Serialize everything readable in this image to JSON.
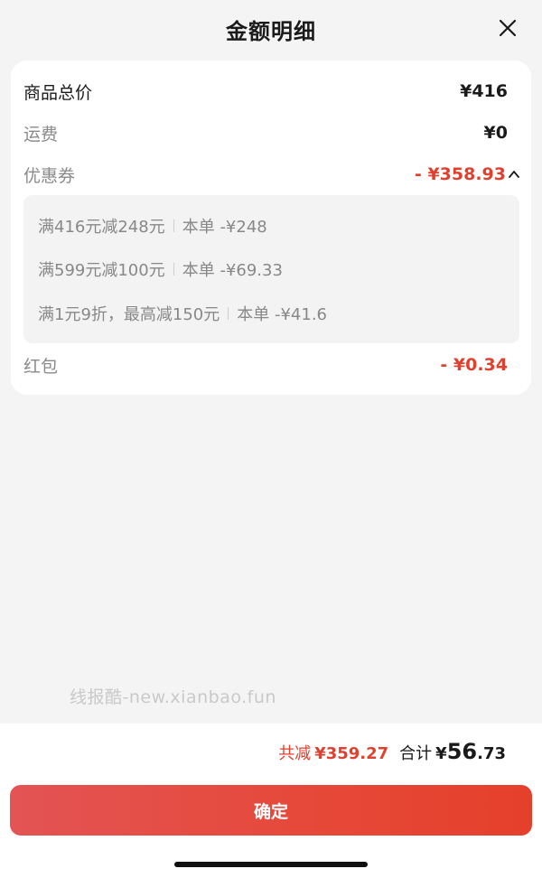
{
  "header": {
    "title": "金额明细",
    "close_icon": "close-icon"
  },
  "details": {
    "goods_total_label": "商品总价",
    "goods_total_value": "¥416",
    "shipping_label": "运费",
    "shipping_value": "¥0",
    "coupon_label": "优惠券",
    "coupon_value": "- ¥358.93",
    "coupon_toggle_icon": "chevron-up-icon",
    "coupons": [
      {
        "rule": "满416元减248元",
        "deduction": "本单 -¥248"
      },
      {
        "rule": "满599元减100元",
        "deduction": "本单 -¥69.33"
      },
      {
        "rule": "满1元9折，最高减150元",
        "deduction": "本单 -¥41.6"
      }
    ],
    "redpacket_label": "红包",
    "redpacket_value": "- ¥0.34"
  },
  "watermark": "线报酷-new.xianbao.fun",
  "footer": {
    "saved_label": "共减",
    "saved_amount": "¥359.27",
    "total_label": "合计",
    "total_currency": "¥",
    "total_integer": "56",
    "total_decimal": ".73",
    "confirm_label": "确定"
  },
  "colors": {
    "accent_red": "#e0412f",
    "button_gradient_start": "#e35454",
    "button_gradient_end": "#e5402c",
    "page_background": "#f4f4f4"
  }
}
